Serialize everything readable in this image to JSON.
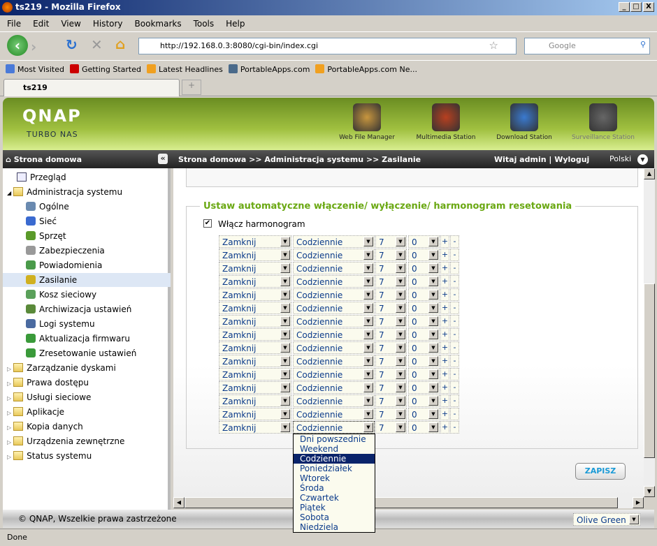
{
  "window": {
    "title": "ts219 - Mozilla Firefox"
  },
  "menu": [
    "File",
    "Edit",
    "View",
    "History",
    "Bookmarks",
    "Tools",
    "Help"
  ],
  "url": "http://192.168.0.3:8080/cgi-bin/index.cgi",
  "search_placeholder": "Google",
  "bookmarks": [
    {
      "label": "Most Visited",
      "color": "#4a7ad8"
    },
    {
      "label": "Getting Started",
      "color": "#c00"
    },
    {
      "label": "Latest Headlines",
      "color": "#f0a020"
    },
    {
      "label": "PortableApps.com",
      "color": "#4a6a8a"
    },
    {
      "label": "PortableApps.com Ne...",
      "color": "#f0a020"
    }
  ],
  "tab": {
    "label": "ts219"
  },
  "header": {
    "logo": "QNAP",
    "sub": "TURBO NAS",
    "apps": [
      {
        "label": "Web File Manager",
        "color": "#c8963e"
      },
      {
        "label": "Multimedia Station",
        "color": "#b84020"
      },
      {
        "label": "Download Station",
        "color": "#3a7ad0"
      },
      {
        "label": "Surveillance Station",
        "color": "#666"
      }
    ]
  },
  "crumb": {
    "home": "Strona domowa",
    "path": "Strona domowa >> Administracja systemu >> Zasilanie",
    "user": "Witaj admin | Wyloguj",
    "lang": "Polski"
  },
  "sidebar": {
    "top": "Przegląd",
    "admin": "Administracja systemu",
    "sub": [
      "Ogólne",
      "Sieć",
      "Sprzęt",
      "Zabezpieczenia",
      "Powiadomienia",
      "Zasilanie",
      "Kosz sieciowy",
      "Archiwizacja ustawień",
      "Logi systemu",
      "Aktualizacja firmwaru",
      "Zresetowanie ustawień"
    ],
    "selected": "Zasilanie",
    "groups": [
      "Zarządzanie dyskami",
      "Prawa dostępu",
      "Usługi sieciowe",
      "Aplikacje",
      "Kopia danych",
      "Urządzenia zewnętrzne",
      "Status systemu"
    ]
  },
  "schedule": {
    "legend": "Ustaw automatyczne włączenie/ wyłączenie/ harmonogram resetowania",
    "enable_label": "Włącz harmonogram",
    "enabled": true,
    "rows": [
      {
        "action": "Zamknij",
        "day": "Codziennie",
        "hour": "7",
        "minute": "0"
      },
      {
        "action": "Zamknij",
        "day": "Codziennie",
        "hour": "7",
        "minute": "0"
      },
      {
        "action": "Zamknij",
        "day": "Codziennie",
        "hour": "7",
        "minute": "0"
      },
      {
        "action": "Zamknij",
        "day": "Codziennie",
        "hour": "7",
        "minute": "0"
      },
      {
        "action": "Zamknij",
        "day": "Codziennie",
        "hour": "7",
        "minute": "0"
      },
      {
        "action": "Zamknij",
        "day": "Codziennie",
        "hour": "7",
        "minute": "0"
      },
      {
        "action": "Zamknij",
        "day": "Codziennie",
        "hour": "7",
        "minute": "0"
      },
      {
        "action": "Zamknij",
        "day": "Codziennie",
        "hour": "7",
        "minute": "0"
      },
      {
        "action": "Zamknij",
        "day": "Codziennie",
        "hour": "7",
        "minute": "0"
      },
      {
        "action": "Zamknij",
        "day": "Codziennie",
        "hour": "7",
        "minute": "0"
      },
      {
        "action": "Zamknij",
        "day": "Codziennie",
        "hour": "7",
        "minute": "0"
      },
      {
        "action": "Zamknij",
        "day": "Codziennie",
        "hour": "7",
        "minute": "0"
      },
      {
        "action": "Zamknij",
        "day": "Codziennie",
        "hour": "7",
        "minute": "0"
      },
      {
        "action": "Zamknij",
        "day": "Codziennie",
        "hour": "7",
        "minute": "0"
      },
      {
        "action": "Zamknij",
        "day": "Codziennie",
        "hour": "7",
        "minute": "0"
      }
    ],
    "plus": "+",
    "minus": "-",
    "day_options": [
      "Dni powszednie",
      "Weekend",
      "Codziennie",
      "Poniedziałek",
      "Wtorek",
      "Środa",
      "Czwartek",
      "Piątek",
      "Sobota",
      "Niedziela"
    ],
    "highlighted": "Codziennie"
  },
  "save": "ZAPISZ",
  "footer": {
    "copyright": "© QNAP, Wszelkie prawa zastrzeżone",
    "theme": "Olive Green"
  },
  "status": "Done"
}
